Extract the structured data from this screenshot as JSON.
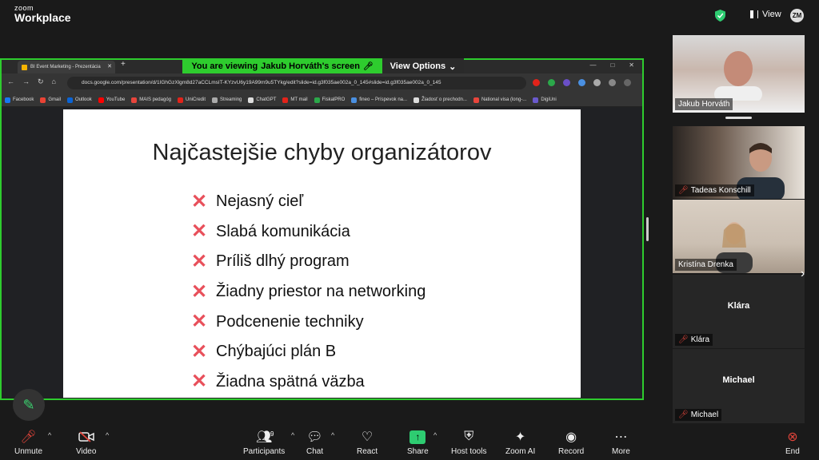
{
  "app": {
    "brand_small": "zoom",
    "brand_big": "Workplace",
    "view_label": "View",
    "avatar_initials": "ZM"
  },
  "share": {
    "banner_prefix": "You are viewing",
    "banner_name": "Jakub Horváth's screen",
    "view_options": "View Options"
  },
  "browser": {
    "tab_title": "BI Event Marketing - Prezentácia",
    "new_tab": "+",
    "url": "docs.google.com/presentation/d/1IGhGzXlgm8d27aCCLmsIT-KYzvU6y19A99m9u5TYkg/edit?slide=id.g3f035ae002a_0_145#slide=id.g3f035ae002a_0_145",
    "bookmarks": [
      {
        "label": "Facebook",
        "color": "#1877f2"
      },
      {
        "label": "Gmail",
        "color": "#ea4335"
      },
      {
        "label": "Outlook",
        "color": "#0a64d6"
      },
      {
        "label": "YouTube",
        "color": "#ff0000"
      },
      {
        "label": "MAIS pedagóg",
        "color": "#e8453c"
      },
      {
        "label": "UniCredit",
        "color": "#e2231a"
      },
      {
        "label": "Streaming",
        "color": "#aaaaaa"
      },
      {
        "label": "ChatGPT",
        "color": "#dddddd"
      },
      {
        "label": "MT mail",
        "color": "#e2231a"
      },
      {
        "label": "FiskalPRO",
        "color": "#2ba84a"
      },
      {
        "label": "fineo – Príspevok na...",
        "color": "#4a90e2"
      },
      {
        "label": "Žiadosť o prechodn...",
        "color": "#dddddd"
      },
      {
        "label": "National visa (long-...",
        "color": "#e8453c"
      },
      {
        "label": "DigiUni",
        "color": "#6a5acd"
      }
    ]
  },
  "slide": {
    "title": "Najčastejšie chyby organizátorov",
    "bullet_mark": "✕",
    "bullets": [
      "Nejasný cieľ",
      "Slabá komunikácia",
      "Príliš dlhý program",
      "Žiadny priestor na networking",
      "Podcenenie techniky",
      "Chýbajúci plán B",
      "Žiadna spätná väzba"
    ]
  },
  "participants": [
    {
      "name": "Jakub Horváth",
      "muted": false
    },
    {
      "name": "Tadeas Konschill",
      "muted": true
    },
    {
      "name": "Kristína Drenka",
      "muted": false
    },
    {
      "name": "Klára",
      "muted": true
    },
    {
      "name": "Michael",
      "muted": true
    }
  ],
  "toolbar": {
    "unmute": "Unmute",
    "video": "Video",
    "participants": "Participants",
    "participants_count": "9",
    "chat": "Chat",
    "react": "React",
    "share": "Share",
    "host_tools": "Host tools",
    "zoom_ai": "Zoom AI",
    "record": "Record",
    "more": "More",
    "end": "End"
  },
  "colors": {
    "share_green": "#2ecc2e",
    "mute_red": "#e0443a",
    "bullet_red": "#e8505b"
  }
}
